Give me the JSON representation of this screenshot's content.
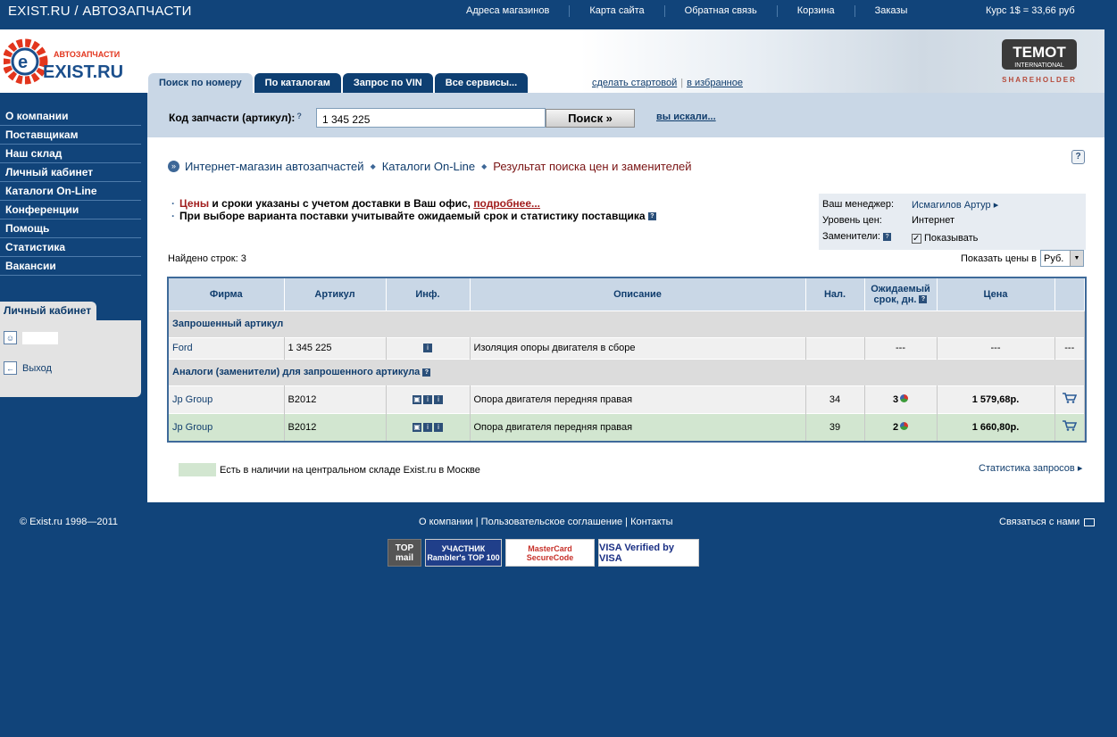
{
  "topbar": {
    "brand": "EXIST.RU / АВТОЗАПЧАСТИ",
    "nav": [
      "Адреса магазинов",
      "Карта сайта",
      "Обратная связь",
      "Корзина",
      "Заказы"
    ],
    "rate": "Курс 1$ = 33,66 руб"
  },
  "logo": {
    "top": "АВТОЗАПЧАСТИ",
    "main": "EXIST.RU"
  },
  "partner": {
    "name": "TEMOT",
    "sub": "INTERNATIONAL",
    "role": "SHAREHOLDER"
  },
  "tabs": [
    {
      "label": "Поиск по номеру",
      "active": true
    },
    {
      "label": "По каталогам",
      "active": false
    },
    {
      "label": "Запрос по VIN",
      "active": false
    },
    {
      "label": "Все сервисы...",
      "active": false
    }
  ],
  "tablinks": {
    "start": "сделать стартовой",
    "fav": "в избранное"
  },
  "sidebar": {
    "items": [
      "О компании",
      "Поставщикам",
      "Наш склад",
      "Личный кабинет",
      "Каталоги On-Line",
      "Конференции",
      "Помощь",
      "Статистика",
      "Вакансии"
    ],
    "cabinet_title": "Личный кабинет",
    "exit": "Выход"
  },
  "search": {
    "label": "Код запчасти (артикул):",
    "value": "1 345 225",
    "button": "Поиск »",
    "history": "вы искали..."
  },
  "breadcrumbs": [
    "Интернет-магазин автозапчастей",
    "Каталоги On-Line",
    "Результат поиска цен и заменителей"
  ],
  "notes": {
    "n1_red": "Цены",
    "n1_text": " и сроки указаны с учетом доставки в Ваш офис, ",
    "n1_link": "подробнее...",
    "n2": "При выборе варианта поставки учитывайте ожидаемый срок и статистику поставщика"
  },
  "manager": {
    "manager_label": "Ваш менеджер:",
    "manager_name": "Исмагилов Артур",
    "level_label": "Уровень цен:",
    "level_value": "Интернет",
    "subs_label": "Заменители:",
    "subs_value": "Показывать"
  },
  "found": "Найдено строк: 3",
  "prices": {
    "label": "Показать цены в",
    "currency": "Руб."
  },
  "table": {
    "headers": [
      "Фирма",
      "Артикул",
      "Инф.",
      "Описание",
      "Нал.",
      "Ожидаемый срок, дн.",
      "Цена"
    ],
    "requested_title": "Запрошенный артикул",
    "requested": {
      "firm": "Ford",
      "article": "1 345 225",
      "desc": "Изоляция опоры двигателя в сборе",
      "qty": "",
      "term": "---",
      "price": "---",
      "buy": "---"
    },
    "analogs_title": "Аналоги (заменители) для запрошенного артикула",
    "analogs": [
      {
        "firm": "Jp Group",
        "article": "B2012",
        "desc": "Опора двигателя передняя правая",
        "qty": "34",
        "term": "3",
        "price": "1 579,68р."
      },
      {
        "firm": "Jp Group",
        "article": "B2012",
        "desc": "Опора двигателя передняя правая",
        "qty": "39",
        "term": "2",
        "price": "1 660,80р."
      }
    ]
  },
  "legend": "Есть в наличии на центральном складе Exist.ru в Москве",
  "stats_link": "Статистика запросов",
  "footer": {
    "copy": "© Exist.ru 1998—2011",
    "links": [
      "О компании",
      "Пользовательское соглашение",
      "Контакты"
    ],
    "contact": "Связаться с нами",
    "badges": [
      "TOP mail",
      "УЧАСТНИК Rambler's TOP 100",
      "MasterCard SecureCode",
      "VISA Verified by VISA"
    ]
  }
}
